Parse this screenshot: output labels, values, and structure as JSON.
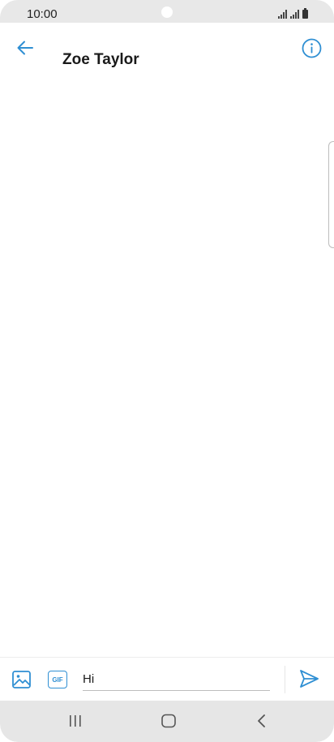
{
  "status_bar": {
    "time": "10:00"
  },
  "header": {
    "contact_name": "Zoe Taylor",
    "back_icon": "arrow-left-icon",
    "info_icon": "info-icon"
  },
  "composer": {
    "message_value": "Hi",
    "gif_label": "GIF",
    "image_icon": "image-icon",
    "send_icon": "send-icon"
  },
  "nav_bar": {
    "recents_icon": "recents-icon",
    "home_icon": "home-icon",
    "back_icon": "back-chevron-icon"
  },
  "colors": {
    "accent": "#2f8fd3",
    "status_bar_bg": "#e8e8e8",
    "nav_bar_bg": "#e6e6e6"
  }
}
